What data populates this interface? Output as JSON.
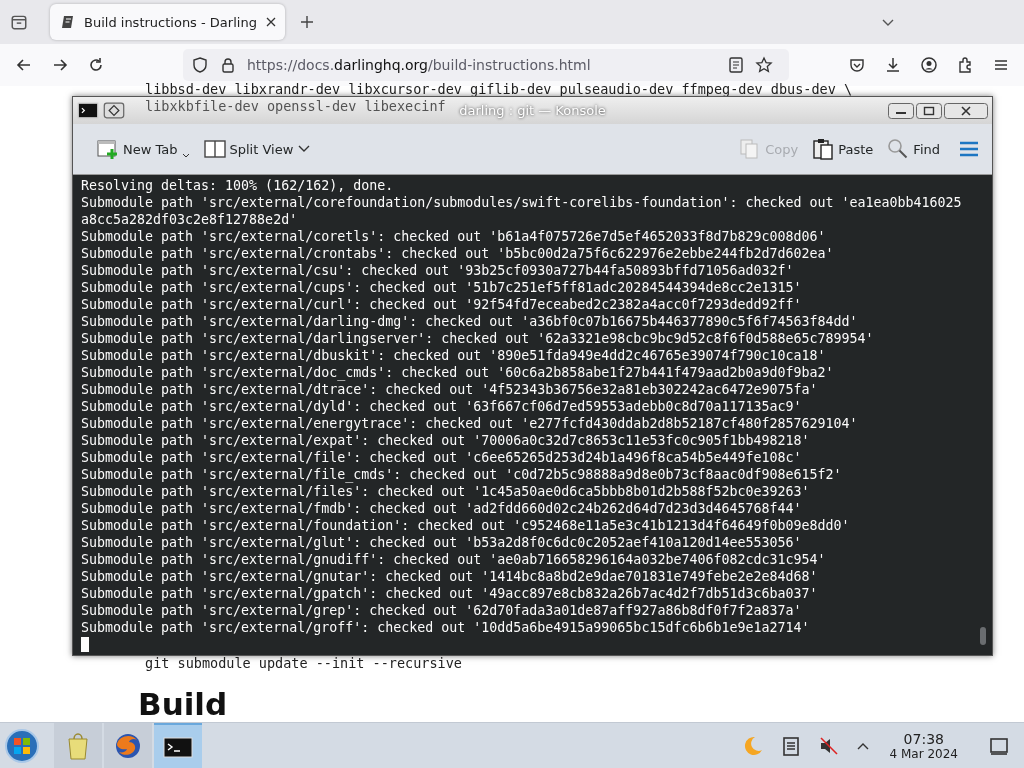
{
  "browser": {
    "tabs": [
      {
        "title": "Build instructions - Darling",
        "selected": true
      }
    ],
    "url": {
      "scheme": "https://docs.",
      "domain": "darlinghq.org",
      "path": "/build-instructions.html"
    }
  },
  "page": {
    "code_lines": [
      "libbsd-dev libxrandr-dev libxcursor-dev giflib-dev pulseaudio-dev ffmpeg-dev dbus-dev \\",
      "libxkbfile-dev openssl-dev libexecinf"
    ],
    "command": "git submodule update --init --recursive",
    "heading": "Build"
  },
  "konsole": {
    "title": "darling : git — Konsole",
    "toolbar": [
      {
        "kind": "new-tab",
        "label": "New Tab",
        "disabled": false
      },
      {
        "kind": "split",
        "label": "Split View",
        "disabled": false
      },
      {
        "kind": "copy",
        "label": "Copy",
        "disabled": true
      },
      {
        "kind": "paste",
        "label": "Paste",
        "disabled": false
      },
      {
        "kind": "find",
        "label": "Find",
        "disabled": false
      }
    ],
    "lines": [
      "Resolving deltas: 100% (162/162), done.",
      "Submodule path 'src/external/corefoundation/submodules/swift-corelibs-foundation': checked out 'ea1ea0bb416025",
      "a8cc5a282df03c2e8f12788e2d'",
      "Submodule path 'src/external/coretls': checked out 'b61a4f075726e7d5ef4652033f8d7b829c008d06'",
      "Submodule path 'src/external/crontabs': checked out 'b5bc00d2a75f6c622976e2ebbe244fb2d7d602ea'",
      "Submodule path 'src/external/csu': checked out '93b25cf0930a727b44fa50893bffd71056ad032f'",
      "Submodule path 'src/external/cups': checked out '51b7c251ef5ff81adc20284544394de8cc2e1315'",
      "Submodule path 'src/external/curl': checked out '92f54fd7eceabed2c2382a4acc0f7293dedd92ff'",
      "Submodule path 'src/external/darling-dmg': checked out 'a36bf0c07b16675b446377890c5f6f74563f84dd'",
      "Submodule path 'src/external/darlingserver': checked out '62a3321e98cbc9bc9d52c8f6f0d588e65c789954'",
      "Submodule path 'src/external/dbuskit': checked out '890e51fda949e4dd2c46765e39074f790c10ca18'",
      "Submodule path 'src/external/doc_cmds': checked out '60c6a2b858abe1f27b441f479aad2b0a9d0f9ba2'",
      "Submodule path 'src/external/dtrace': checked out '4f52343b36756e32a81eb302242ac6472e9075fa'",
      "Submodule path 'src/external/dyld': checked out '63f667cf06d7ed59553adebb0c8d70a117135ac9'",
      "Submodule path 'src/external/energytrace': checked out 'e277fcfd430ddab2d8b52187cf480f2857629104'",
      "Submodule path 'src/external/expat': checked out '70006a0c32d7c8653c11e53fc0c905f1bb498218'",
      "Submodule path 'src/external/file': checked out 'c6ee65265d253d24b1a496f8ca54b5e449fe108c'",
      "Submodule path 'src/external/file_cmds': checked out 'c0d72b5c98888a9d8e0b73cf8aac0df908e615f2'",
      "Submodule path 'src/external/files': checked out '1c45a50ae0d6ca5bbb8b01d2b588f52bc0e39263'",
      "Submodule path 'src/external/fmdb': checked out 'ad2fdd660d02c24b262d64d7d23d3d4645768f44'",
      "Submodule path 'src/external/foundation': checked out 'c952468e11a5e3c41b1213d4f64649f0b09e8dd0'",
      "Submodule path 'src/external/glut': checked out 'b53a2d8f0c6dc0c2052aef410a120d14ee553056'",
      "Submodule path 'src/external/gnudiff': checked out 'ae0ab716658296164a032be7406f082cdc31c954'",
      "Submodule path 'src/external/gnutar': checked out '1414bc8a8bd2e9dae701831e749febe2e2e84d68'",
      "Submodule path 'src/external/gpatch': checked out '49acc897e8cb832a26b7ac4d2f7db51d3c6ba037'",
      "Submodule path 'src/external/grep': checked out '62d70fada3a01de87aff927a86b8df0f7f2a837a'",
      "Submodule path 'src/external/groff': checked out '10dd5a6be4915a99065bc15dfc6b6b1e9e1a2714'"
    ]
  },
  "taskbar": {
    "apps": [
      {
        "kind": "files",
        "active": false
      },
      {
        "kind": "browser",
        "active": false
      },
      {
        "kind": "terminal",
        "active": true
      }
    ],
    "clock": {
      "time": "07:38",
      "date": "4 Mar 2024"
    }
  }
}
